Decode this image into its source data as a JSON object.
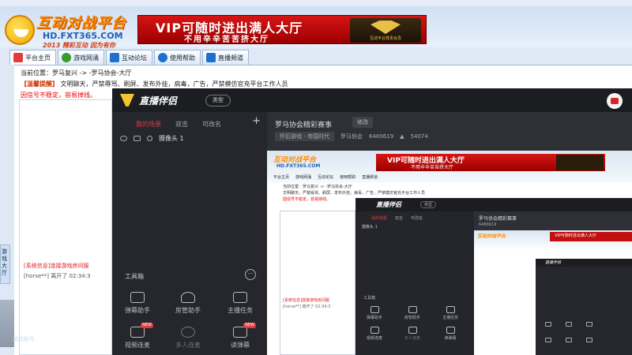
{
  "site": {
    "logo_title": "互动对战平台",
    "logo_url": "HD.FXT365.COM",
    "logo_slogan": "2013 精彩互动 因为有你",
    "vip_main": "VIP可随时进出满人大厅",
    "vip_sub": "不用辛辛苦苦挤大厅",
    "vip_badge_text": "互动平台尊贵会员"
  },
  "nav": {
    "items": [
      {
        "label": "平台主页",
        "color": "#e23b3b"
      },
      {
        "label": "游戏网涌",
        "color": "#3a9a2c"
      },
      {
        "label": "互动论坛",
        "color": "#1d6fd0"
      },
      {
        "label": "使用帮助",
        "color": "#1d6fd0"
      },
      {
        "label": "直播频道",
        "color": "#1d6fd0"
      }
    ]
  },
  "page": {
    "breadcrumb": "当前位置：罗马复兴 -> -罗马协会-大厅",
    "notice_tag": "【温馨提醒】",
    "notice_text": "文明聊天，严禁辱骂、刷屏、发布外挂，病毒，广告，严禁模仿官充平台工作人员",
    "warning": "因信号不稳定，容易掉线。",
    "sys_msg": "[系统信息]连接游戏房间服",
    "chat_msg": "[horse**] 离开了 02:34:3",
    "side_tab": "游戏大厅",
    "side_label": "游戏帐号"
  },
  "app": {
    "name": "直播伴侣",
    "type_button": "类型",
    "tabs": [
      "我的场景",
      "双击",
      "可改名"
    ],
    "add_symbol": "+",
    "scene_label": "摄像头 1",
    "toolbox_title": "工具箱",
    "toolbox_more": "···",
    "tools": [
      {
        "label": "弹幕助手",
        "dim": false,
        "badge": ""
      },
      {
        "label": "房管助手",
        "dim": false,
        "badge": ""
      },
      {
        "label": "主播任务",
        "dim": false,
        "badge": ""
      },
      {
        "label": "视频连麦",
        "dim": false,
        "badge": "NEW"
      },
      {
        "label": "多人连麦",
        "dim": true,
        "badge": ""
      },
      {
        "label": "读弹幕",
        "dim": false,
        "badge": "NEW"
      }
    ],
    "room_title": "罗马协会精彩赛事",
    "edit_button": "修改",
    "room_category": "怀旧游戏 - 帝国时代",
    "room_org": "罗马协会",
    "room_id": "6480619",
    "room_heat": "54074"
  }
}
